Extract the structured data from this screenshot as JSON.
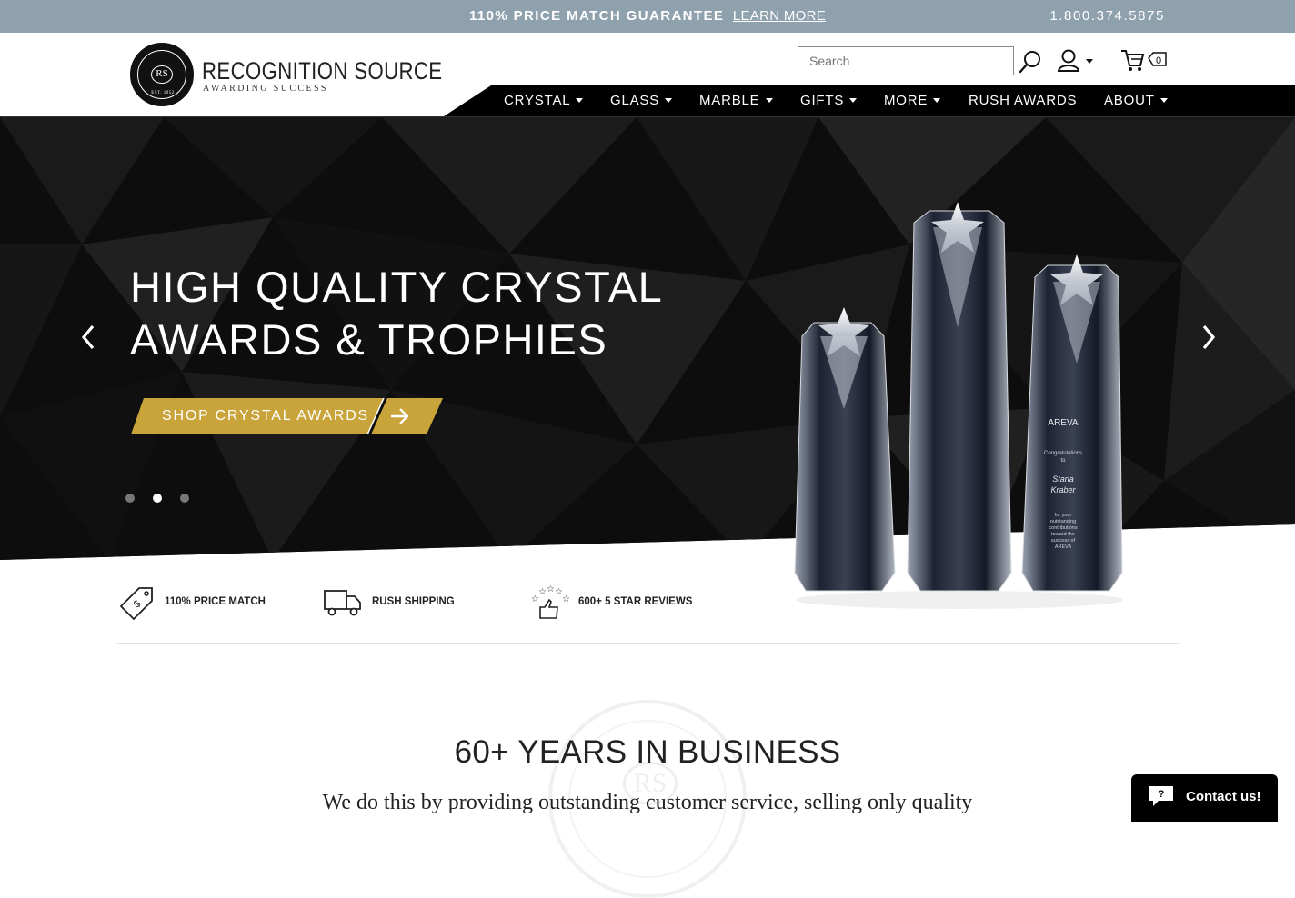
{
  "topbar": {
    "promo_text": "110% PRICE MATCH GUARANTEE",
    "promo_link": "LEARN MORE",
    "phone": "1.800.374.5875"
  },
  "brand": {
    "name": "RECOGNITION SOURCE",
    "tagline": "AWARDING SUCCESS",
    "monogram": "RS",
    "est": "EST. 1952"
  },
  "search": {
    "placeholder": "Search"
  },
  "cart": {
    "count": "0"
  },
  "nav": {
    "items": [
      {
        "label": "CRYSTAL",
        "dropdown": true
      },
      {
        "label": "GLASS",
        "dropdown": true
      },
      {
        "label": "MARBLE",
        "dropdown": true
      },
      {
        "label": "GIFTS",
        "dropdown": true
      },
      {
        "label": "MORE",
        "dropdown": true
      },
      {
        "label": "RUSH AWARDS",
        "dropdown": false
      },
      {
        "label": "ABOUT",
        "dropdown": true
      }
    ]
  },
  "hero": {
    "title_line1": "HIGH QUALITY CRYSTAL",
    "title_line2": "AWARDS & TROPHIES",
    "cta": "SHOP CRYSTAL AWARDS",
    "active_slide": 2,
    "slide_count": 3,
    "trophy_text": {
      "logo": "AREVA",
      "line1": "Congratulations",
      "line2": "to",
      "name1": "Starla",
      "name2": "Kraber",
      "body": [
        "for your",
        "outstanding",
        "contributions",
        "toward the",
        "success of",
        "AREVA"
      ]
    }
  },
  "features": [
    {
      "icon": "price-tag-icon",
      "label": "110% PRICE MATCH"
    },
    {
      "icon": "delivery-truck-icon",
      "label": "RUSH SHIPPING"
    },
    {
      "icon": "star-reviews-icon",
      "label": "600+ 5 STAR REVIEWS"
    }
  ],
  "about": {
    "heading": "60+ YEARS IN BUSINESS",
    "lead": "We do this by providing outstanding customer service, selling only quality"
  },
  "chat": {
    "label": "Contact us!"
  },
  "colors": {
    "topbar": "#8fa1ad",
    "nav": "#000000",
    "cta_gold": "#c9a43a",
    "hero_dark": "#0c0c0c"
  }
}
